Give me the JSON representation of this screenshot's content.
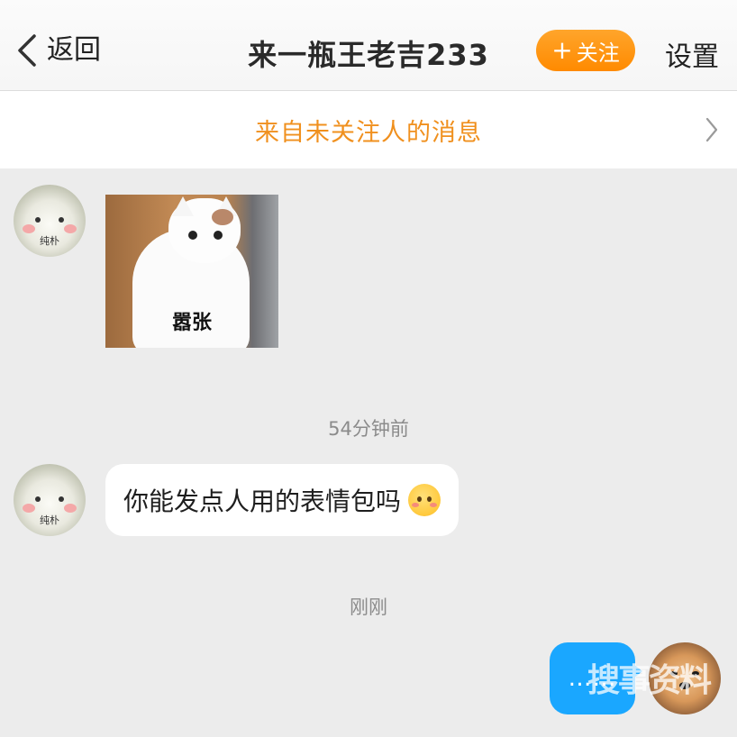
{
  "navbar": {
    "back_label": "返回",
    "title": "来一瓶王老吉233",
    "follow_label": "关注",
    "settings_label": "设置"
  },
  "notice": {
    "text": "来自未关注人的消息"
  },
  "messages": [
    {
      "direction": "incoming",
      "type": "sticker",
      "avatar_tag": "纯朴",
      "sticker_caption": "嚣张"
    },
    {
      "type": "timestamp",
      "text": "54分钟前"
    },
    {
      "direction": "incoming",
      "type": "text",
      "avatar_tag": "纯朴",
      "text": "你能发点人用的表情包吗",
      "emoji": "flushed-face"
    },
    {
      "type": "timestamp",
      "text": "刚刚"
    },
    {
      "direction": "outgoing",
      "type": "text",
      "text": "……"
    }
  ],
  "watermark": "搜事资料",
  "colors": {
    "accent_orange": "#ff8a00",
    "notice_orange": "#f0901e",
    "outgoing_bubble": "#1aa7ff",
    "background": "#ececec"
  }
}
